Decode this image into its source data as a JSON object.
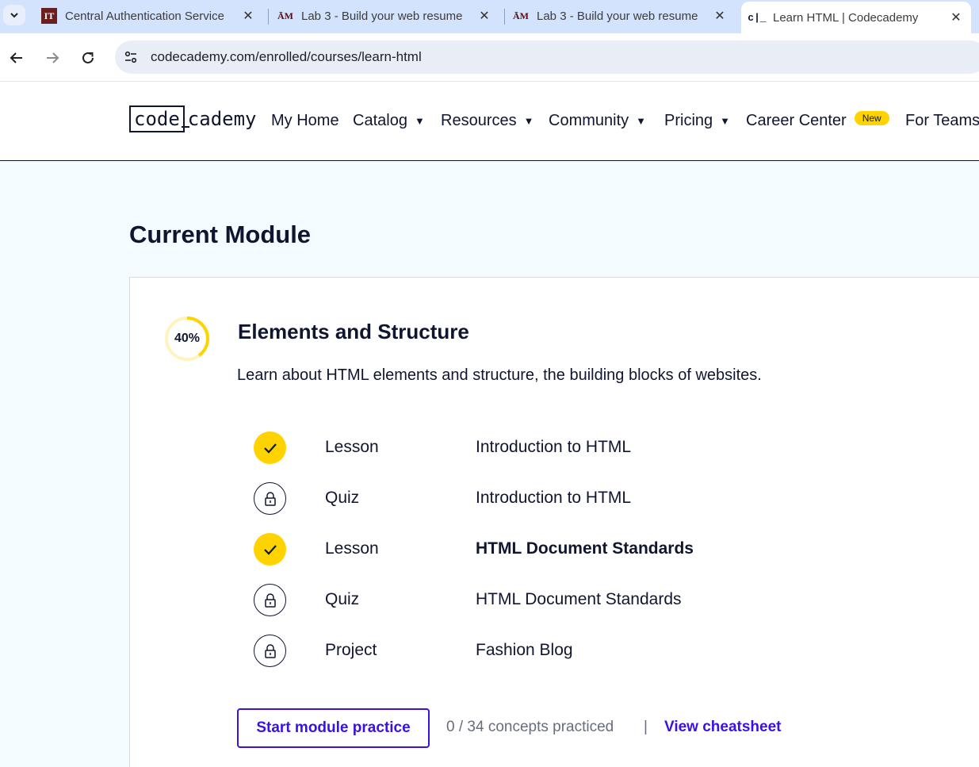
{
  "browser": {
    "tabs": [
      {
        "title": "Central Authentication Service",
        "favicon": "IT",
        "icon": "it-favicon",
        "active": false
      },
      {
        "title": "Lab 3 - Build your web resume",
        "favicon": "ĀM",
        "icon": "tamu-favicon",
        "active": false
      },
      {
        "title": "Lab 3 - Build your web resume",
        "favicon": "ĀM",
        "icon": "tamu-favicon",
        "active": false
      },
      {
        "title": "Learn HTML | Codecademy",
        "favicon": "c|_",
        "icon": "codecademy-favicon",
        "active": true
      }
    ],
    "close_glyph": "✕",
    "url": "codecademy.com/enrolled/courses/learn-html"
  },
  "header": {
    "logo": {
      "box": "code",
      "rest": "cademy"
    },
    "nav": [
      {
        "label": "My Home",
        "has_caret": false
      },
      {
        "label": "Catalog",
        "has_caret": true
      },
      {
        "label": "Resources",
        "has_caret": true
      },
      {
        "label": "Community",
        "has_caret": true
      },
      {
        "label": "Pricing",
        "has_caret": true
      },
      {
        "label": "Career Center",
        "has_caret": false,
        "badge": "New"
      },
      {
        "label": "For Teams",
        "has_caret": false
      }
    ],
    "caret_glyph": "▼"
  },
  "main": {
    "section_title": "Current Module",
    "module": {
      "progress_label": "40%",
      "progress_fraction": 0.4,
      "title": "Elements and Structure",
      "description": "Learn about HTML elements and structure, the building blocks of websites.",
      "items": [
        {
          "type": "Lesson",
          "name": "Introduction to HTML",
          "status": "done",
          "current": false
        },
        {
          "type": "Quiz",
          "name": "Introduction to HTML",
          "status": "locked",
          "current": false
        },
        {
          "type": "Lesson",
          "name": "HTML Document Standards",
          "status": "done",
          "current": true
        },
        {
          "type": "Quiz",
          "name": "HTML Document Standards",
          "status": "locked",
          "current": false
        },
        {
          "type": "Project",
          "name": "Fashion Blog",
          "status": "locked",
          "current": false
        }
      ],
      "practice_button": "Start module practice",
      "concepts_text": "0 / 34 concepts practiced",
      "separator": "|",
      "cheatsheet_link": "View cheatsheet"
    }
  },
  "colors": {
    "accent": "#3a10e5",
    "yellow": "#ffd300",
    "navy": "#10162f",
    "page_bg": "#f5fcff"
  }
}
